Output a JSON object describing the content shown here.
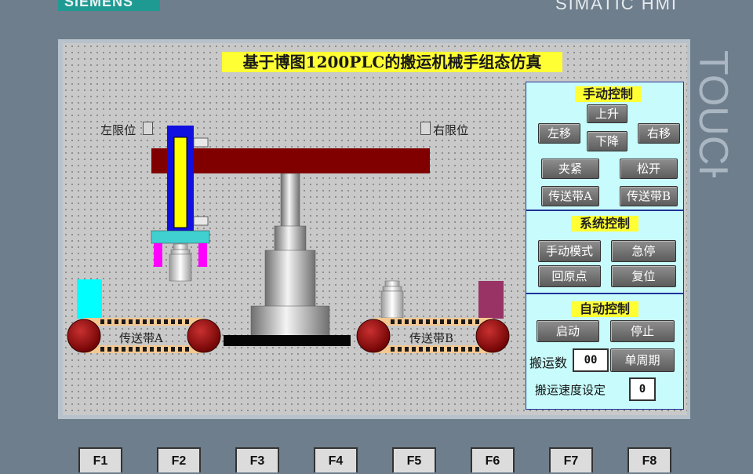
{
  "brand": {
    "left": "SIEMENS",
    "right": "SIMATIC HMI",
    "side": "TOUCH"
  },
  "title": "基于博图1200PLC的搬运机械手组态仿真",
  "limits": {
    "left": "左限位",
    "right": "右限位"
  },
  "belts": {
    "a": "传送带A",
    "b": "传送带B"
  },
  "manual": {
    "title": "手动控制",
    "up": "上升",
    "left": "左移",
    "down": "下降",
    "right": "右移",
    "clamp": "夹紧",
    "release": "松开",
    "belt_a": "传送带A",
    "belt_b": "传送带B"
  },
  "system": {
    "title": "系统控制",
    "manual_mode": "手动模式",
    "estop": "急停",
    "home": "回原点",
    "reset": "复位"
  },
  "auto": {
    "title": "自动控制",
    "start": "启动",
    "stop": "停止",
    "count_label": "搬运数",
    "count_value": "00",
    "single_cycle": "单周期",
    "speed_label": "搬运速度设定",
    "speed_value": "0"
  },
  "fkeys": [
    "F1",
    "F2",
    "F3",
    "F4",
    "F5",
    "F6",
    "F7",
    "F8"
  ],
  "colors": {
    "beam": "#800000",
    "cylinder_outer": "#1010e0",
    "cylinder_inner": "#ffff00",
    "gripper_plate": "#40d0d0",
    "gripper_finger": "#ff00ff",
    "box_a": "#00ffff",
    "box_b": "#993366",
    "roller": "#990000",
    "panel_bg": "#c8fbfb",
    "title_bg": "#ffff33"
  }
}
